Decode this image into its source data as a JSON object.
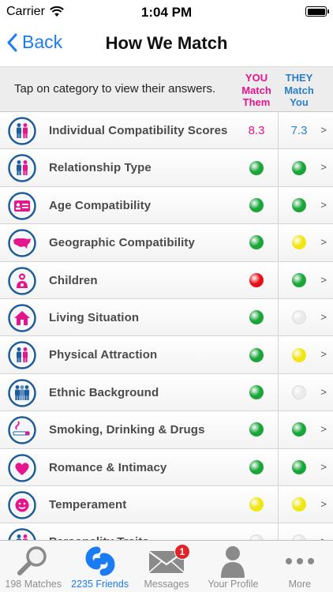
{
  "status_bar": {
    "carrier": "Carrier",
    "time": "1:04 PM"
  },
  "nav": {
    "back_label": "Back",
    "title": "How We Match"
  },
  "header": {
    "hint": "Tap on category to view their answers.",
    "you_col": [
      "YOU",
      "Match",
      "Them"
    ],
    "they_col": [
      "THEY",
      "Match",
      "You"
    ]
  },
  "colors": {
    "green": "#1aa539",
    "yellow": "#f0e612",
    "red": "#e5101a",
    "gray": "#ebebeb",
    "pink": "#e5168c",
    "blue": "#2a7fc6",
    "ios_blue": "#1a7cf5"
  },
  "rows": [
    {
      "label": "Individual Compatibility Scores",
      "icon": "couple-icon",
      "you_score": "8.3",
      "they_score": "7.3",
      "chevron": ">"
    },
    {
      "label": "Relationship Type",
      "icon": "couple-icon",
      "you": "green",
      "they": "green",
      "chevron": ">"
    },
    {
      "label": "Age Compatibility",
      "icon": "id-card-icon",
      "you": "green",
      "they": "green",
      "chevron": ">"
    },
    {
      "label": "Geographic Compatibility",
      "icon": "usa-map-icon",
      "you": "green",
      "they": "yellow",
      "chevron": ">"
    },
    {
      "label": "Children",
      "icon": "baby-icon",
      "you": "red",
      "they": "green",
      "chevron": ">"
    },
    {
      "label": "Living Situation",
      "icon": "house-icon",
      "you": "green",
      "they": "gray",
      "chevron": ">"
    },
    {
      "label": "Physical Attraction",
      "icon": "couple-icon",
      "you": "green",
      "they": "yellow",
      "chevron": ">"
    },
    {
      "label": "Ethnic Background",
      "icon": "people-icon",
      "you": "green",
      "they": "gray",
      "chevron": ">"
    },
    {
      "label": "Smoking, Drinking & Drugs",
      "icon": "cigarette-icon",
      "you": "green",
      "they": "green",
      "chevron": ">"
    },
    {
      "label": "Romance & Intimacy",
      "icon": "heart-icon",
      "you": "green",
      "they": "green",
      "chevron": ">"
    },
    {
      "label": "Temperament",
      "icon": "face-icon",
      "you": "yellow",
      "they": "yellow",
      "chevron": ">"
    },
    {
      "label": "Personality Traits",
      "icon": "couple-icon",
      "you": "gray",
      "they": "gray",
      "chevron": ">"
    }
  ],
  "tabs": [
    {
      "label": "198 Matches",
      "icon": "magnifier-icon",
      "active": false
    },
    {
      "label": "2235 Friends",
      "icon": "friends-link-icon",
      "active": true
    },
    {
      "label": "Messages",
      "icon": "envelope-icon",
      "active": false,
      "badge": "1"
    },
    {
      "label": "Your Profile",
      "icon": "person-icon",
      "active": false
    },
    {
      "label": "More",
      "icon": "more-dots-icon",
      "active": false
    }
  ]
}
